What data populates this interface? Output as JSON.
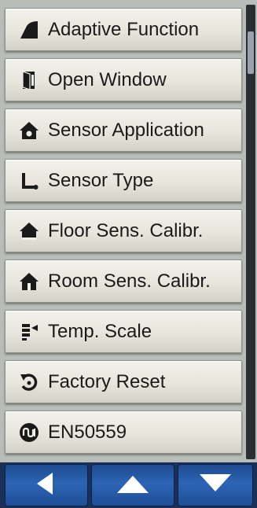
{
  "menu": {
    "items": [
      {
        "label": "Adaptive Function",
        "icon": "adaptive-function-icon"
      },
      {
        "label": "Open Window",
        "icon": "open-window-icon"
      },
      {
        "label": "Sensor Application",
        "icon": "sensor-application-icon"
      },
      {
        "label": "Sensor Type",
        "icon": "sensor-type-icon"
      },
      {
        "label": "Floor Sens. Calibr.",
        "icon": "floor-sensor-icon"
      },
      {
        "label": "Room Sens. Calibr.",
        "icon": "room-sensor-icon"
      },
      {
        "label": "Temp. Scale",
        "icon": "temp-scale-icon"
      },
      {
        "label": "Factory Reset",
        "icon": "factory-reset-icon"
      },
      {
        "label": "EN50559",
        "icon": "en50559-icon"
      }
    ]
  },
  "navigation": {
    "buttons": [
      {
        "icon": "arrow-left-icon"
      },
      {
        "icon": "arrow-up-icon"
      },
      {
        "icon": "arrow-down-icon"
      }
    ]
  },
  "colors": {
    "button_face": "#e7e5dc",
    "nav_button": "#2c64b4",
    "icon": "#1a1a1a"
  }
}
